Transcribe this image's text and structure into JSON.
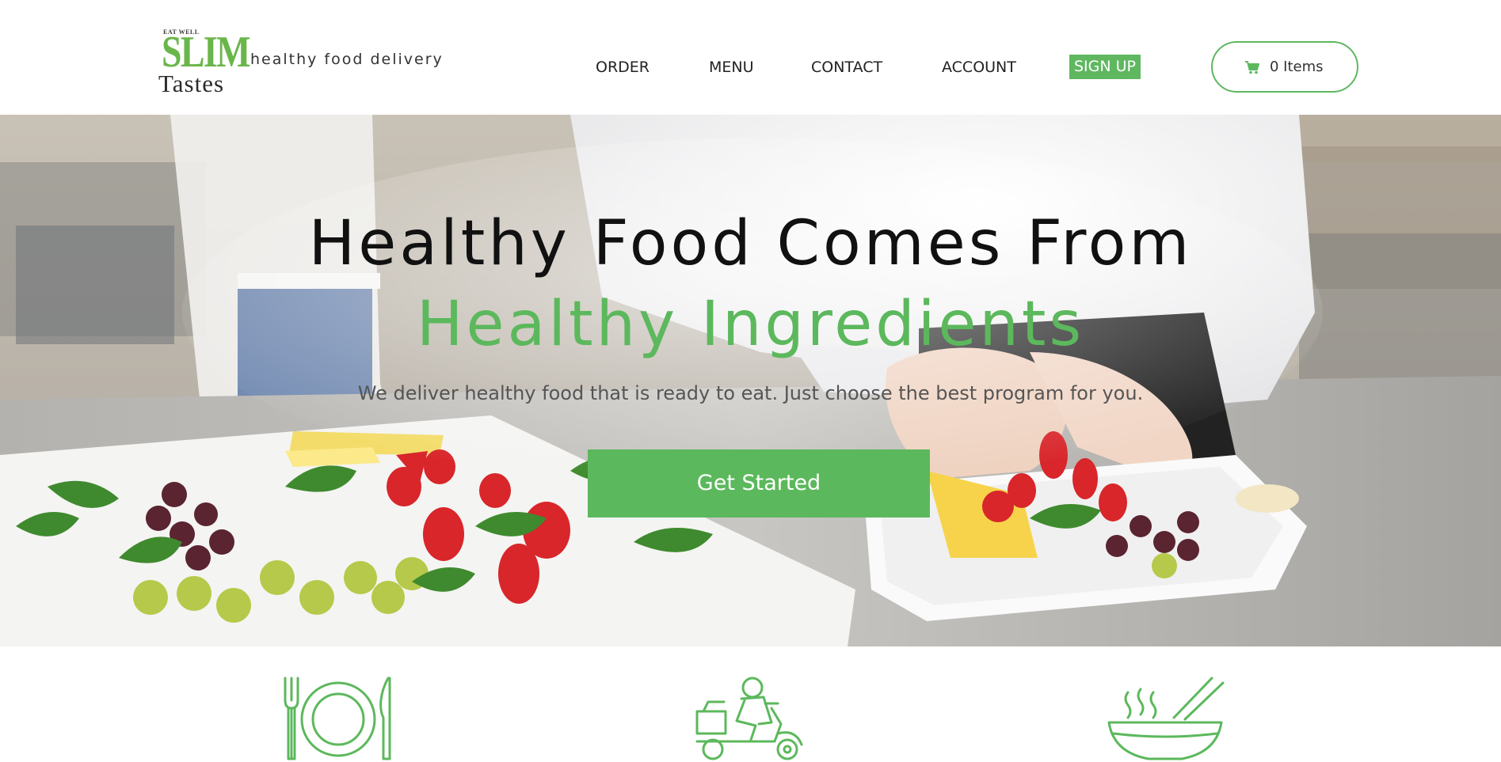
{
  "brand": {
    "eat_well": "EAT WELL",
    "name_top": "SLIM",
    "name_bottom": "Tastes",
    "tagline": "healthy food delivery",
    "accent_color": "#5cb85c"
  },
  "nav": {
    "items": [
      {
        "label": "ORDER"
      },
      {
        "label": "MENU"
      },
      {
        "label": "CONTACT"
      },
      {
        "label": "ACCOUNT"
      },
      {
        "label": "SIGN UP",
        "highlight_color": "#5fb760"
      }
    ]
  },
  "cart": {
    "icon": "cart-icon",
    "label": "0 Items"
  },
  "hero": {
    "title_line1": "Healthy Food Comes From",
    "title_line2": "Healthy Ingredients",
    "subtitle": "We deliver healthy food that is ready to eat. Just choose the best program for you.",
    "cta_label": "Get Started"
  },
  "features": {
    "icons": [
      "plate-fork-knife-icon",
      "delivery-scooter-icon",
      "hot-bowl-chopsticks-icon"
    ]
  }
}
